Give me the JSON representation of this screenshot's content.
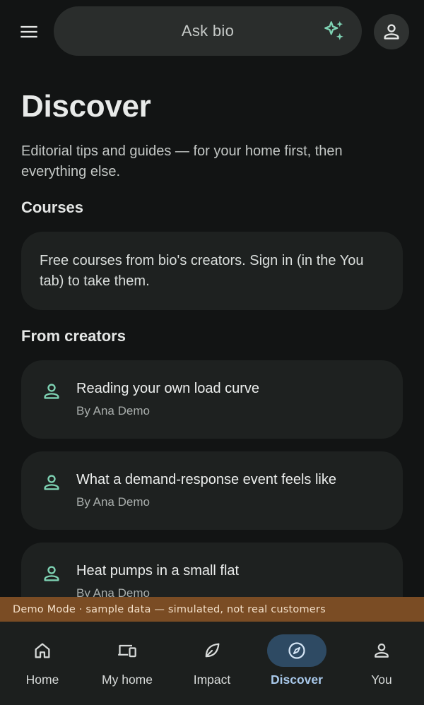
{
  "search": {
    "label": "Ask bio"
  },
  "page": {
    "title": "Discover",
    "intro": "Editorial tips and guides — for your home first, then everything else."
  },
  "courses": {
    "title": "Courses",
    "card_text": "Free courses from bio's creators. Sign in (in the You tab) to take them."
  },
  "creators": {
    "title": "From creators",
    "articles": [
      {
        "title": "Reading your own load curve",
        "author": "By Ana Demo"
      },
      {
        "title": "What a demand-response event feels like",
        "author": "By Ana Demo"
      },
      {
        "title": "Heat pumps in a small flat",
        "author": "By Ana Demo"
      }
    ]
  },
  "demo_banner": "Demo Mode · sample data — simulated, not real customers",
  "nav": {
    "items": [
      {
        "label": "Home",
        "icon": "home-icon"
      },
      {
        "label": "My home",
        "icon": "devices-icon"
      },
      {
        "label": "Impact",
        "icon": "leaf-icon"
      },
      {
        "label": "Discover",
        "icon": "compass-icon",
        "active": true
      },
      {
        "label": "You",
        "icon": "person-icon"
      }
    ]
  },
  "colors": {
    "background": "#121414",
    "card": "#1e2120",
    "accent_green": "#7fd3b4",
    "active_nav_bg": "#2e4a63",
    "active_nav_text": "#a8c8ea",
    "demo_banner": "#7a4c24"
  }
}
